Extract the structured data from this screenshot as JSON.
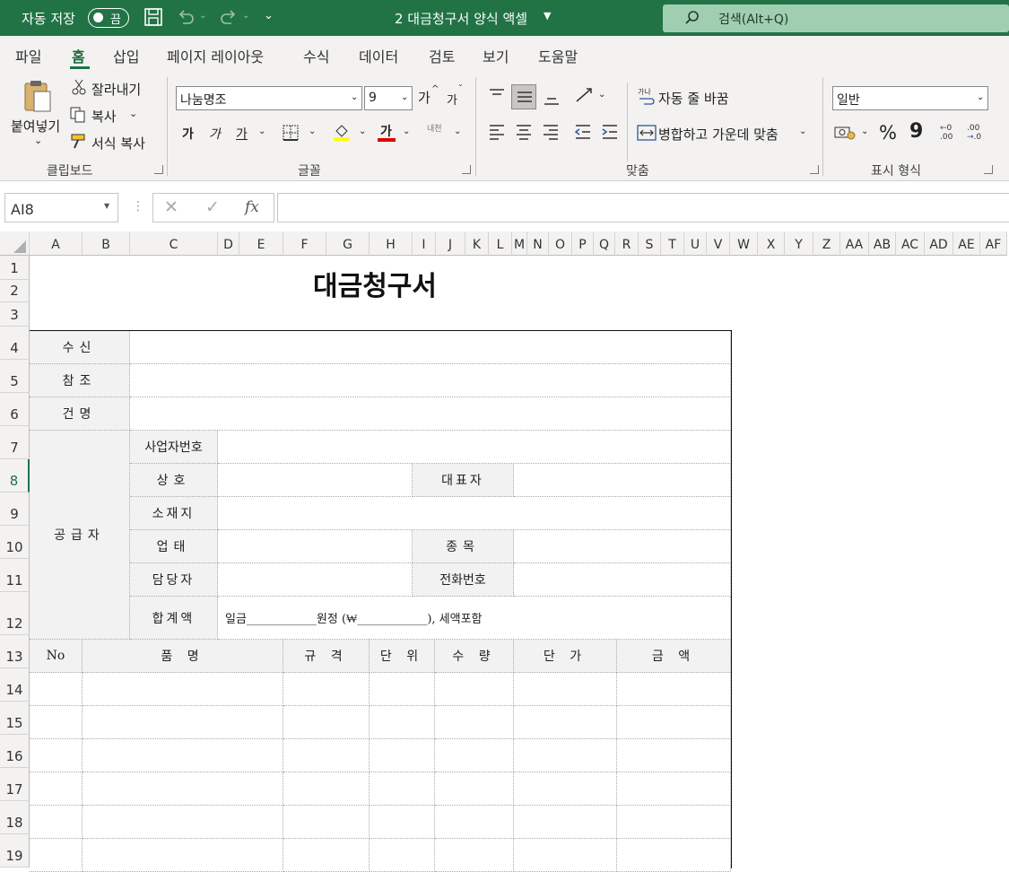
{
  "titlebar": {
    "autosave_label": "자동 저장",
    "autosave_state": "끔",
    "doc_title": "2 대금청구서 양식 액셀",
    "search_placeholder": "검색(Alt+Q)",
    "bg_color": "#217346"
  },
  "menu_tabs": [
    {
      "label": "파일"
    },
    {
      "label": "홈",
      "active": true
    },
    {
      "label": "삽입"
    },
    {
      "label": "페이지 레이아웃"
    },
    {
      "label": "수식"
    },
    {
      "label": "데이터"
    },
    {
      "label": "검토"
    },
    {
      "label": "보기"
    },
    {
      "label": "도움말"
    }
  ],
  "ribbon": {
    "clipboard": {
      "paste": "붙여넣기",
      "cut": "잘라내기",
      "copy": "복사",
      "format_painter": "서식 복사",
      "group": "클립보드"
    },
    "font": {
      "font_name": "나눔명조",
      "font_size": "9",
      "grow": "가",
      "shrink": "가",
      "bold": "가",
      "italic": "가",
      "underline": "가",
      "font_color_glyph": "가",
      "phonetic": "내천",
      "group": "글꼴"
    },
    "alignment": {
      "wrap_text": "자동 줄 바꿈",
      "merge_center": "병합하고 가운데 맞춤",
      "group": "맞춤"
    },
    "number": {
      "format": "일반",
      "percent": "%",
      "comma": "9",
      "inc_decimal": ".00",
      "dec_decimal": ".00",
      "group": "표시 형식"
    }
  },
  "formula_bar": {
    "name_box": "AI8",
    "fx": "fx",
    "content": ""
  },
  "columns": [
    "A",
    "B",
    "C",
    "D",
    "E",
    "F",
    "G",
    "H",
    "I",
    "J",
    "K",
    "L",
    "M",
    "N",
    "O",
    "P",
    "Q",
    "R",
    "S",
    "T",
    "U",
    "V",
    "W",
    "X",
    "Y",
    "Z",
    "AA",
    "AB",
    "AC",
    "AD",
    "AE",
    "AF"
  ],
  "rows": [
    "1",
    "2",
    "3",
    "4",
    "5",
    "6",
    "7",
    "8",
    "9",
    "10",
    "11",
    "12",
    "13",
    "14",
    "15",
    "16",
    "17",
    "18",
    "19"
  ],
  "invoice": {
    "title": "대금청구서",
    "recipient": "수신",
    "reference": "참조",
    "subject": "건명",
    "supplier": "공급자",
    "biz_number": "사업자번호",
    "company": "상호",
    "representative": "대표자",
    "address": "소재지",
    "biz_type": "업태",
    "biz_item": "종목",
    "contact": "담당자",
    "phone": "전화번호",
    "total": "합계액",
    "total_text": "일금____________원정 (₩____________), 세액포함",
    "items_header": {
      "no": "No",
      "name": "품 명",
      "spec": "규 격",
      "unit": "단 위",
      "qty": "수 량",
      "price": "단 가",
      "amount": "금 액"
    }
  }
}
